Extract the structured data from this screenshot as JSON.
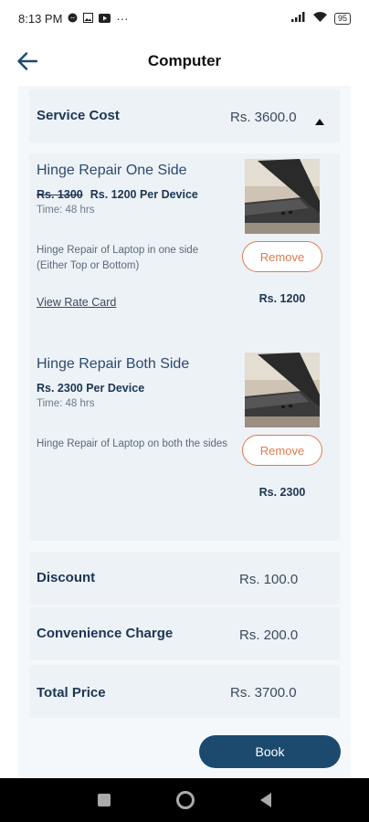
{
  "status_bar": {
    "time": "8:13 PM",
    "left_icons": [
      "messenger-icon",
      "image-icon",
      "youtube-icon",
      "more-dots-icon"
    ],
    "dots": "···",
    "battery": "95"
  },
  "header": {
    "title": "Computer"
  },
  "service_cost": {
    "label": "Service Cost",
    "value": "Rs. 3600.0"
  },
  "items": [
    {
      "name": "Hinge Repair One Side",
      "old_price": "Rs. 1300",
      "price_line": "Rs. 1200 Per Device",
      "time": "Time: 48 hrs",
      "description": "Hinge Repair of Laptop in one side (Either Top or Bottom)",
      "rate_card_link": "View Rate Card",
      "remove_label": "Remove",
      "price": "Rs. 1200"
    },
    {
      "name": "Hinge Repair Both Side",
      "price_line": "Rs. 2300 Per Device",
      "time": "Time: 48 hrs",
      "description": "Hinge Repair of Laptop on both the sides",
      "remove_label": "Remove",
      "price": "Rs. 2300"
    }
  ],
  "discount": {
    "label": "Discount",
    "value": "Rs. 100.0"
  },
  "convenience": {
    "label": "Convenience Charge",
    "value": "Rs. 200.0"
  },
  "total": {
    "label": "Total Price",
    "value": "Rs. 3700.0"
  },
  "book_label": "Book",
  "colors": {
    "primary": "#1b4a6e",
    "accent": "#e07a50",
    "card": "#edf2f7"
  }
}
